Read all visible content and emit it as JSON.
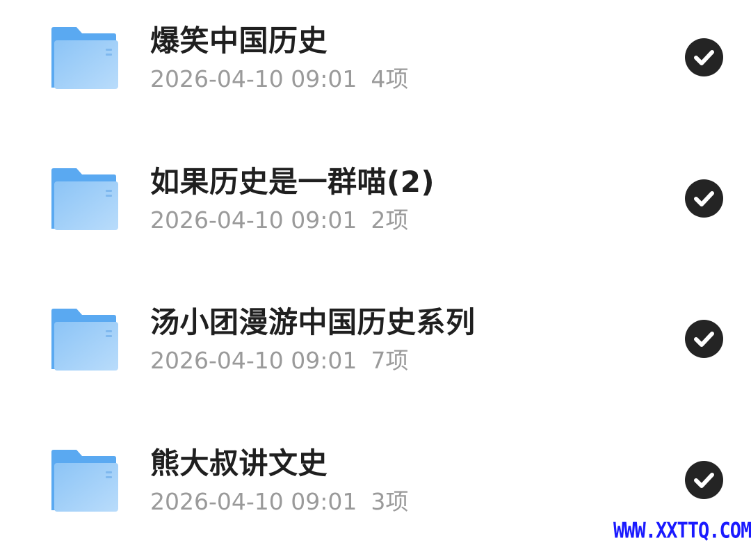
{
  "folders": [
    {
      "title": "爆笑中国历史",
      "date": "2026-04-10 09:01",
      "count": "4项",
      "selected": true
    },
    {
      "title": "如果历史是一群喵(2)",
      "date": "2026-04-10 09:01",
      "count": "2项",
      "selected": true
    },
    {
      "title": "汤小团漫游中国历史系列",
      "date": "2026-04-10 09:01",
      "count": "7项",
      "selected": true
    },
    {
      "title": "熊大叔讲文史",
      "date": "2026-04-10 09:01",
      "count": "3项",
      "selected": true
    }
  ],
  "icons": {
    "folder": "folder-icon",
    "check": "check-circle-icon"
  },
  "colors": {
    "folder_back": "#5aa9f1",
    "folder_front_light": "#b9dcfb",
    "folder_front_dark": "#8cc4f6",
    "check_bg": "#242424",
    "title": "#1f1f1f",
    "meta": "#9a9a9a",
    "watermark": "#1a1aff"
  },
  "watermark": "WWW.XXTTQ.COM"
}
